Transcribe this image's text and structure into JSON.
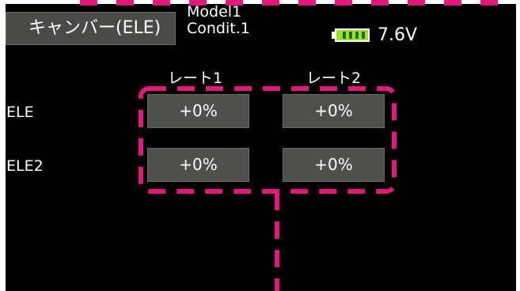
{
  "screen": {
    "title": "キャンバー(ELE)",
    "model": "Model1",
    "condition": "Condit.1",
    "battery": {
      "voltage": "7.6V",
      "level": 1.0,
      "fill_color": "#9be02c",
      "icon": "battery-icon"
    }
  },
  "rates": {
    "headers": [
      "レート1",
      "レート2"
    ],
    "rows": [
      {
        "label": "ELE",
        "values": [
          "+0%",
          "+0%"
        ]
      },
      {
        "label": "ELE2",
        "values": [
          "+0%",
          "+0%"
        ]
      }
    ]
  },
  "theme": {
    "background": "#000000",
    "button": "#4f4f4c",
    "highlight": "#e0197b"
  }
}
